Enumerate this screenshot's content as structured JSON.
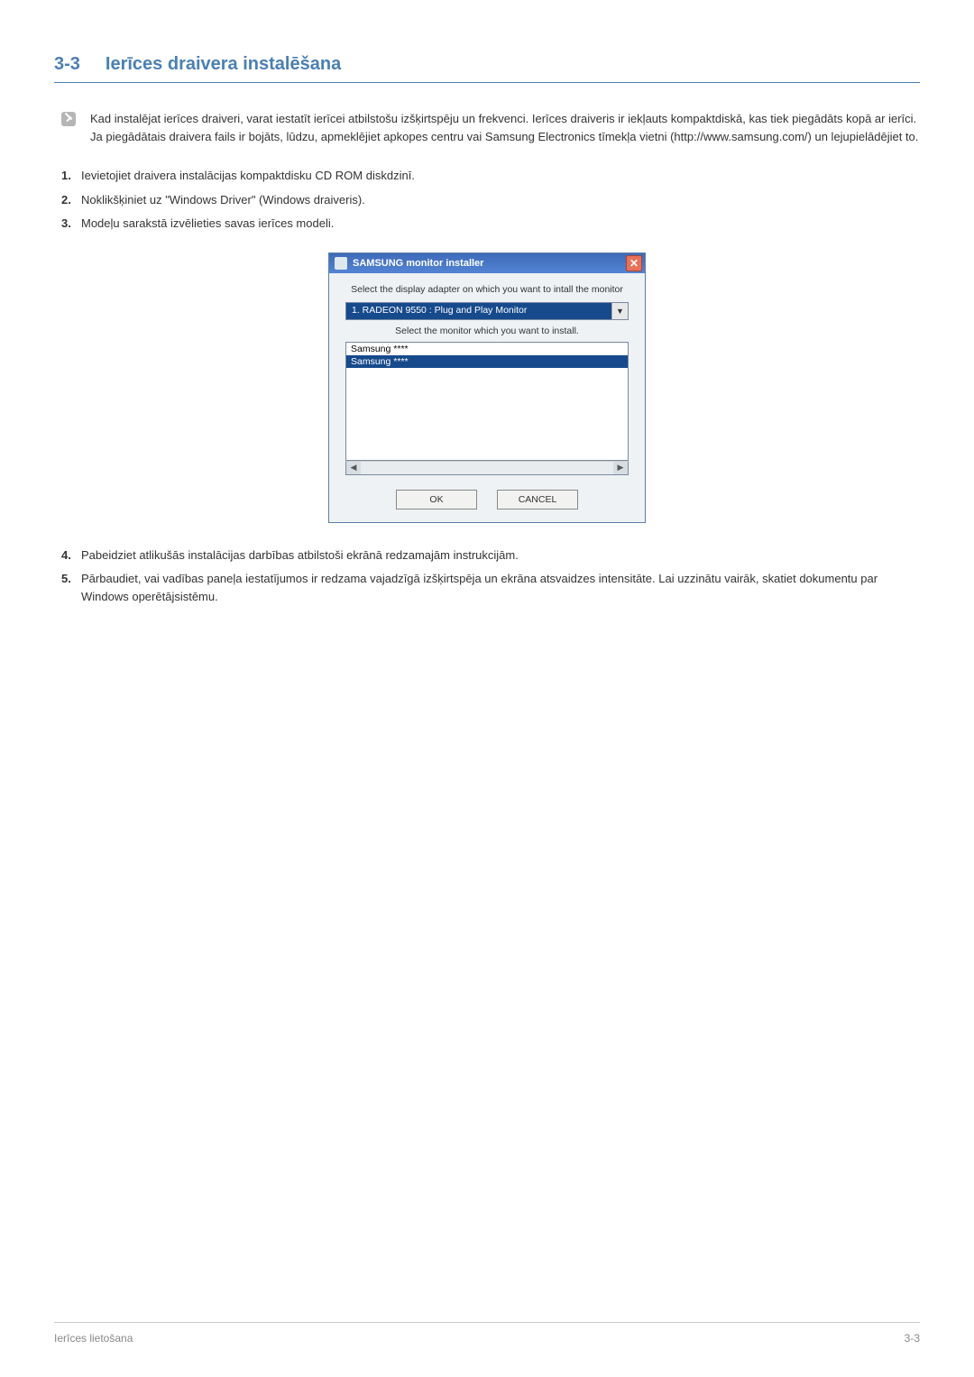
{
  "header": {
    "number": "3-3",
    "title": "Ierīces draivera instalēšana"
  },
  "info": {
    "text": "Kad instalējat ierīces draiveri, varat iestatīt ierīcei atbilstošu izšķirtspēju un frekvenci. Ierīces draiveris ir iekļauts kompaktdiskā, kas tiek piegādāts kopā ar ierīci. Ja piegādātais draivera fails ir bojāts, lūdzu, apmeklējiet apkopes centru vai Samsung Electronics tīmekļa vietni (http://www.samsung.com/) un lejupielādējiet to."
  },
  "steps_a": [
    {
      "n": "1.",
      "text": "Ievietojiet draivera instalācijas kompaktdisku CD ROM diskdzinī."
    },
    {
      "n": "2.",
      "text": "Noklikšķiniet uz \"Windows Driver\" (Windows draiveris)."
    },
    {
      "n": "3.",
      "text": "Modeļu sarakstā izvēlieties savas ierīces modeli."
    }
  ],
  "installer": {
    "title": "SAMSUNG monitor installer",
    "label1": "Select the display adapter on which you want to intall the monitor",
    "dropdown_value": "1. RADEON 9550 : Plug and Play Monitor",
    "label2": "Select the monitor which you want to install.",
    "list_items": [
      "Samsung ****",
      "Samsung ****"
    ],
    "ok": "OK",
    "cancel": "CANCEL"
  },
  "steps_b": [
    {
      "n": "4.",
      "text": "Pabeidziet atlikušās instalācijas darbības atbilstoši ekrānā redzamajām instrukcijām."
    },
    {
      "n": "5.",
      "text": "Pārbaudiet, vai vadības paneļa iestatījumos ir redzama vajadzīgā izšķirtspēja un ekrāna atsvaidzes intensitāte. Lai uzzinātu vairāk, skatiet dokumentu par Windows operētājsistēmu."
    }
  ],
  "footer": {
    "left": "Ierīces lietošana",
    "right": "3-3"
  }
}
